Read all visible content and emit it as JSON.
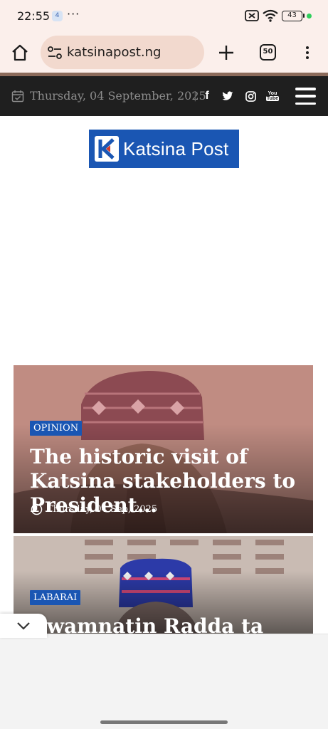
{
  "status_bar": {
    "time": "22:55",
    "notification_badge": "4",
    "more_dots": "···",
    "battery_level": "43",
    "indicator_color": "#2fcf5c"
  },
  "browser": {
    "url": "katsinapost.ng",
    "tab_count": "50",
    "page_load_progress": 1.0,
    "icons": [
      "home-icon",
      "site-settings-icon",
      "plus-icon",
      "tabs-icon",
      "overflow-menu-icon"
    ]
  },
  "site_header": {
    "date": "Thursday, 04 September, 2025",
    "separator": "|",
    "social": {
      "facebook": "f",
      "youtube_top": "You",
      "youtube_bottom": "Tube"
    },
    "background_color": "#1f1f1f"
  },
  "logo": {
    "text": "Katsina Post",
    "brand_color": "#1a56b3"
  },
  "articles": [
    {
      "category": "OPINION",
      "title": "The historic visit of Katsina stakeholders to President…",
      "date": "Thursday, 04 Sep, 2025"
    },
    {
      "category": "LABARAI",
      "title": "Gwamnatin Radda ta kashe"
    }
  ]
}
